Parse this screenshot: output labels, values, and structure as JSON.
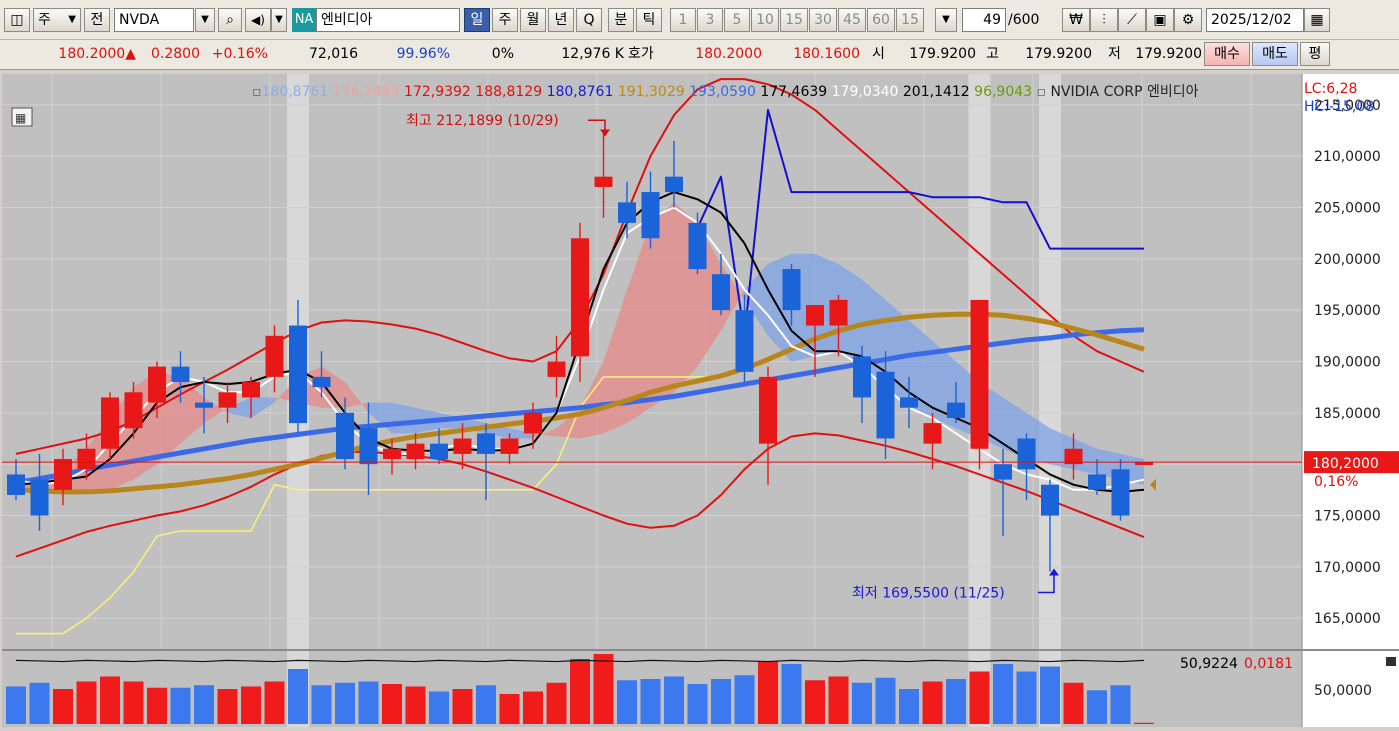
{
  "toolbar": {
    "market_select": "주",
    "prev_label": "전",
    "symbol": "NVDA",
    "ticker_badge": "NA",
    "name": "엔비디아",
    "periods": [
      "일",
      "주",
      "월",
      "년",
      "Q",
      "분",
      "틱"
    ],
    "active_period": "일",
    "intervals": [
      "1",
      "3",
      "5",
      "10",
      "15",
      "30",
      "45",
      "60",
      "15"
    ],
    "count_value": "49",
    "count_total": "/600",
    "date": "2025/12/02"
  },
  "quote": {
    "price": "180.2000",
    "change": "0.2800",
    "change_pct": "+0.16%",
    "volume": "72,016",
    "ratio": "99.96%",
    "zero_pct": "0%",
    "amount": "12,976 K",
    "ask_label": "호가",
    "ask": "180.2000",
    "bid": "180.1600",
    "open_label": "시",
    "open": "179.9200",
    "high_label": "고",
    "high": "179.9200",
    "low_label": "저",
    "low": "179.9200",
    "buy_label": "매수",
    "sell_label": "매도",
    "eval_label": "평"
  },
  "legend": {
    "values": [
      {
        "text": "180,8761",
        "color": "#8eaee8"
      },
      {
        "text": "176,7469",
        "color": "#f2a0a0"
      },
      {
        "text": "172,9392",
        "color": "#e01010"
      },
      {
        "text": "188,8129",
        "color": "#e01010"
      },
      {
        "text": "180,8761",
        "color": "#1a1ad0"
      },
      {
        "text": "191,3029",
        "color": "#c08a10"
      },
      {
        "text": "193,0590",
        "color": "#3a6ae8"
      },
      {
        "text": "177,4639",
        "color": "#000000"
      },
      {
        "text": "179,0340",
        "color": "#ffffff"
      },
      {
        "text": "201,1412",
        "color": "#000000"
      },
      {
        "text": "96,9043",
        "color": "#6a9a10"
      }
    ],
    "company": "NVIDIA CORP  엔비디아",
    "lc": "LC:6,28",
    "hc": "HC:-15,08"
  },
  "annotations": {
    "high": "최고 212,1899 (10/29)",
    "low": "최저 169,5500 (11/25)"
  },
  "price_tag": {
    "value": "180,2000",
    "pct": "0,16%"
  },
  "volume_panel": {
    "value_black": "50,9224",
    "value_red": "0,0181",
    "axis_label": "50,0000"
  },
  "chart_data": {
    "type": "candlestick",
    "y_axis": {
      "min": 162,
      "max": 218,
      "ticks": [
        "215,0000",
        "210,0000",
        "205,0000",
        "200,0000",
        "195,0000",
        "190,0000",
        "185,0000",
        "180,0000",
        "175,0000",
        "170,0000",
        "165,0000"
      ]
    },
    "candles": [
      {
        "o": 179.0,
        "h": 180.5,
        "l": 176.5,
        "c": 177.0,
        "v": 30
      },
      {
        "o": 178.5,
        "h": 181.0,
        "l": 173.5,
        "c": 175.0,
        "v": 33
      },
      {
        "o": 177.5,
        "h": 181.5,
        "l": 176.0,
        "c": 180.5,
        "v": 28
      },
      {
        "o": 179.5,
        "h": 183.0,
        "l": 178.5,
        "c": 181.5,
        "v": 34
      },
      {
        "o": 181.5,
        "h": 187.0,
        "l": 180.5,
        "c": 186.5,
        "v": 38
      },
      {
        "o": 183.5,
        "h": 188.0,
        "l": 182.5,
        "c": 187.0,
        "v": 34
      },
      {
        "o": 186.0,
        "h": 190.0,
        "l": 184.5,
        "c": 189.5,
        "v": 29
      },
      {
        "o": 189.5,
        "h": 191.0,
        "l": 186.0,
        "c": 188.0,
        "v": 29
      },
      {
        "o": 186.0,
        "h": 188.5,
        "l": 183.0,
        "c": 185.5,
        "v": 31
      },
      {
        "o": 185.5,
        "h": 188.0,
        "l": 184.0,
        "c": 187.0,
        "v": 28
      },
      {
        "o": 186.5,
        "h": 188.5,
        "l": 184.5,
        "c": 188.0,
        "v": 30
      },
      {
        "o": 188.5,
        "h": 193.5,
        "l": 187.0,
        "c": 192.5,
        "v": 34
      },
      {
        "o": 193.5,
        "h": 196.0,
        "l": 183.0,
        "c": 184.0,
        "v": 44
      },
      {
        "o": 188.5,
        "h": 191.0,
        "l": 186.5,
        "c": 187.5,
        "v": 31
      },
      {
        "o": 185.0,
        "h": 186.5,
        "l": 179.5,
        "c": 180.5,
        "v": 33
      },
      {
        "o": 183.5,
        "h": 186.0,
        "l": 177.0,
        "c": 180.0,
        "v": 34
      },
      {
        "o": 180.5,
        "h": 182.5,
        "l": 179.0,
        "c": 181.5,
        "v": 32
      },
      {
        "o": 180.5,
        "h": 183.0,
        "l": 179.5,
        "c": 182.0,
        "v": 30
      },
      {
        "o": 182.0,
        "h": 183.5,
        "l": 180.0,
        "c": 180.5,
        "v": 26
      },
      {
        "o": 181.0,
        "h": 184.0,
        "l": 179.5,
        "c": 182.5,
        "v": 28
      },
      {
        "o": 183.0,
        "h": 184.0,
        "l": 176.5,
        "c": 181.0,
        "v": 31
      },
      {
        "o": 181.0,
        "h": 183.0,
        "l": 180.0,
        "c": 182.5,
        "v": 24
      },
      {
        "o": 183.0,
        "h": 186.0,
        "l": 181.5,
        "c": 185.0,
        "v": 26
      },
      {
        "o": 188.5,
        "h": 192.5,
        "l": 186.5,
        "c": 190.0,
        "v": 33
      },
      {
        "o": 190.5,
        "h": 203.5,
        "l": 188.0,
        "c": 202.0,
        "v": 52
      },
      {
        "o": 207.0,
        "h": 212.2,
        "l": 204.0,
        "c": 208.0,
        "v": 56
      },
      {
        "o": 205.5,
        "h": 207.5,
        "l": 202.0,
        "c": 203.5,
        "v": 35
      },
      {
        "o": 206.5,
        "h": 208.5,
        "l": 201.0,
        "c": 202.0,
        "v": 36
      },
      {
        "o": 208.0,
        "h": 211.5,
        "l": 205.0,
        "c": 206.5,
        "v": 38
      },
      {
        "o": 203.5,
        "h": 204.5,
        "l": 198.5,
        "c": 199.0,
        "v": 32
      },
      {
        "o": 198.5,
        "h": 200.5,
        "l": 194.5,
        "c": 195.0,
        "v": 36
      },
      {
        "o": 195.0,
        "h": 196.5,
        "l": 188.0,
        "c": 189.0,
        "v": 39
      },
      {
        "o": 182.0,
        "h": 189.5,
        "l": 178.0,
        "c": 188.5,
        "v": 50
      },
      {
        "o": 199.0,
        "h": 199.5,
        "l": 193.5,
        "c": 195.0,
        "v": 48
      },
      {
        "o": 193.5,
        "h": 195.5,
        "l": 188.5,
        "c": 195.5,
        "v": 35
      },
      {
        "o": 193.5,
        "h": 196.5,
        "l": 190.5,
        "c": 196.0,
        "v": 38
      },
      {
        "o": 190.5,
        "h": 191.5,
        "l": 184.0,
        "c": 186.5,
        "v": 33
      },
      {
        "o": 189.0,
        "h": 191.0,
        "l": 180.5,
        "c": 182.5,
        "v": 37
      },
      {
        "o": 186.5,
        "h": 188.5,
        "l": 183.5,
        "c": 185.5,
        "v": 28
      },
      {
        "o": 182.0,
        "h": 185.0,
        "l": 179.5,
        "c": 184.0,
        "v": 34
      },
      {
        "o": 186.0,
        "h": 188.0,
        "l": 184.0,
        "c": 184.5,
        "v": 36
      },
      {
        "o": 181.5,
        "h": 196.0,
        "l": 179.5,
        "c": 196.0,
        "v": 42
      },
      {
        "o": 180.0,
        "h": 181.5,
        "l": 173.0,
        "c": 178.5,
        "v": 48
      },
      {
        "o": 182.5,
        "h": 183.0,
        "l": 176.5,
        "c": 179.5,
        "v": 42
      },
      {
        "o": 178.0,
        "h": 178.5,
        "l": 169.55,
        "c": 175.0,
        "v": 46
      },
      {
        "o": 180.0,
        "h": 183.0,
        "l": 178.5,
        "c": 181.5,
        "v": 33
      },
      {
        "o": 179.0,
        "h": 180.5,
        "l": 177.0,
        "c": 177.5,
        "v": 27
      },
      {
        "o": 179.5,
        "h": 180.5,
        "l": 174.5,
        "c": 175.0,
        "v": 31
      },
      {
        "o": 179.92,
        "h": 179.92,
        "l": 179.92,
        "c": 180.2,
        "v": 1
      }
    ],
    "lines": {
      "env_upper": [
        181.0,
        181.5,
        182.0,
        182.5,
        183.2,
        184.2,
        185.5,
        186.8,
        188.0,
        189.2,
        190.5,
        191.8,
        193.0,
        193.8,
        194.0,
        193.9,
        193.6,
        193.2,
        192.6,
        191.8,
        191.0,
        190.3,
        190.0,
        191.0,
        194.0,
        198.5,
        204.5,
        210.0,
        214.0,
        216.5,
        217.5,
        217.5,
        217.0,
        216.0,
        214.5,
        212.5,
        210.5,
        208.5,
        206.5,
        204.5,
        202.5,
        200.5,
        198.5,
        196.5,
        194.5,
        192.5,
        191.0,
        190.0,
        189.0
      ],
      "env_lower": [
        171.0,
        171.8,
        172.6,
        173.4,
        174.0,
        174.5,
        175.0,
        175.4,
        176.0,
        176.8,
        177.8,
        179.0,
        180.0,
        180.8,
        181.2,
        181.2,
        181.0,
        180.8,
        180.5,
        180.0,
        179.3,
        178.5,
        177.7,
        176.8,
        175.9,
        175.0,
        174.2,
        173.8,
        174.0,
        175.0,
        177.0,
        179.5,
        181.5,
        182.7,
        183.0,
        182.8,
        182.3,
        181.8,
        181.2,
        180.5,
        179.8,
        179.0,
        178.2,
        177.4,
        176.5,
        175.6,
        174.7,
        173.8,
        172.9
      ],
      "ma_blue": [
        null,
        null,
        null,
        null,
        null,
        null,
        null,
        null,
        null,
        null,
        null,
        null,
        null,
        null,
        null,
        null,
        null,
        null,
        null,
        null,
        null,
        null,
        null,
        null,
        null,
        null,
        null,
        null,
        null,
        203.0,
        208.0,
        192.5,
        214.5,
        206.5,
        206.5,
        206.5,
        206.5,
        206.5,
        206.5,
        206.0,
        206.0,
        206.0,
        205.5,
        205.5,
        201.0,
        201.0,
        201.0,
        201.0,
        201.0
      ],
      "ma_yellow": [
        163.5,
        163.5,
        163.5,
        165.0,
        167.0,
        169.5,
        173.0,
        173.5,
        173.5,
        173.5,
        173.5,
        178.0,
        177.5,
        177.5,
        177.5,
        177.5,
        177.5,
        177.5,
        177.5,
        177.5,
        177.5,
        177.5,
        177.5,
        180.0,
        185.5,
        188.5,
        188.5,
        188.5,
        188.5,
        188.5,
        188.5,
        null,
        null,
        null,
        null,
        null,
        null,
        null,
        null,
        null,
        null,
        null,
        null,
        null,
        null,
        null,
        null,
        null,
        null
      ],
      "ma_white": [
        178.5,
        178.0,
        178.3,
        179.5,
        182.0,
        184.5,
        187.0,
        188.5,
        188.0,
        187.0,
        187.0,
        188.5,
        189.0,
        187.0,
        184.0,
        182.0,
        181.0,
        181.0,
        181.5,
        182.0,
        181.5,
        181.5,
        182.0,
        185.0,
        190.5,
        197.0,
        202.5,
        204.0,
        205.0,
        203.5,
        200.5,
        197.0,
        194.5,
        191.5,
        190.5,
        191.0,
        189.5,
        187.5,
        185.5,
        184.5,
        183.0,
        181.5,
        180.0,
        179.0,
        178.5,
        177.5,
        177.5,
        178.0,
        178.5
      ],
      "ma_black": [
        178.0,
        178.2,
        178.5,
        178.8,
        180.5,
        183.0,
        186.0,
        187.5,
        188.0,
        187.8,
        188.0,
        188.8,
        189.2,
        188.0,
        185.0,
        182.5,
        181.5,
        181.3,
        181.3,
        181.5,
        181.3,
        181.4,
        182.0,
        185.0,
        192.0,
        199.0,
        203.5,
        205.5,
        206.5,
        205.8,
        204.5,
        201.5,
        197.0,
        193.0,
        191.0,
        191.0,
        190.5,
        189.0,
        187.0,
        185.5,
        184.5,
        183.5,
        182.0,
        180.5,
        179.0,
        178.0,
        177.5,
        177.3,
        177.5
      ],
      "ma_gold": [
        177.5,
        177.4,
        177.3,
        177.3,
        177.4,
        177.6,
        177.8,
        178.0,
        178.3,
        178.6,
        179.0,
        179.5,
        180.0,
        180.6,
        181.2,
        181.8,
        182.3,
        182.7,
        183.0,
        183.3,
        183.6,
        183.9,
        184.2,
        184.5,
        184.9,
        185.5,
        186.2,
        187.0,
        187.6,
        188.1,
        188.6,
        189.3,
        190.2,
        191.2,
        192.2,
        193.0,
        193.6,
        194.0,
        194.3,
        194.5,
        194.6,
        194.6,
        194.5,
        194.2,
        193.8,
        193.2,
        192.6,
        191.9,
        191.2
      ],
      "ma_royal": [
        178.2,
        178.6,
        179.0,
        179.5,
        179.9,
        180.3,
        180.7,
        181.1,
        181.5,
        181.9,
        182.3,
        182.6,
        182.9,
        183.2,
        183.5,
        183.7,
        183.9,
        184.1,
        184.3,
        184.5,
        184.7,
        184.9,
        185.1,
        185.3,
        185.5,
        185.8,
        186.0,
        186.3,
        186.6,
        187.0,
        187.4,
        187.8,
        188.2,
        188.6,
        189.0,
        189.4,
        189.8,
        190.2,
        190.6,
        190.9,
        191.2,
        191.5,
        191.8,
        192.1,
        192.3,
        192.6,
        192.8,
        193.0,
        193.1
      ],
      "cloud_a": [
        178.0,
        178.5,
        179.5,
        181.5,
        184.5,
        187.5,
        189.0,
        188.5,
        186.5,
        185.0,
        184.5,
        186.0,
        188.5,
        189.5,
        188.0,
        185.0,
        183.0,
        183.0,
        183.5,
        183.5,
        183.0,
        182.5,
        182.5,
        183.5,
        185.5,
        190.0,
        197.0,
        203.5,
        205.5,
        203.5,
        199.5,
        196.0,
        192.5,
        190.0,
        190.5,
        191.0,
        189.5,
        187.5,
        185.5,
        184.5,
        183.5,
        182.5,
        181.5,
        180.5,
        180.0,
        179.5,
        179.0,
        178.5,
        178.0
      ],
      "cloud_b": [
        177.8,
        177.5,
        177.3,
        177.2,
        177.5,
        178.5,
        180.0,
        182.0,
        184.0,
        185.5,
        186.5,
        186.5,
        186.0,
        185.5,
        185.5,
        186.0,
        186.0,
        185.5,
        185.0,
        184.5,
        184.0,
        183.5,
        183.0,
        182.7,
        182.5,
        183.0,
        184.0,
        185.5,
        187.0,
        189.5,
        193.0,
        197.0,
        199.5,
        200.5,
        200.5,
        199.5,
        198.0,
        196.0,
        194.0,
        192.0,
        190.0,
        188.0,
        186.5,
        185.0,
        183.5,
        182.5,
        181.5,
        181.0,
        180.5
      ]
    }
  }
}
